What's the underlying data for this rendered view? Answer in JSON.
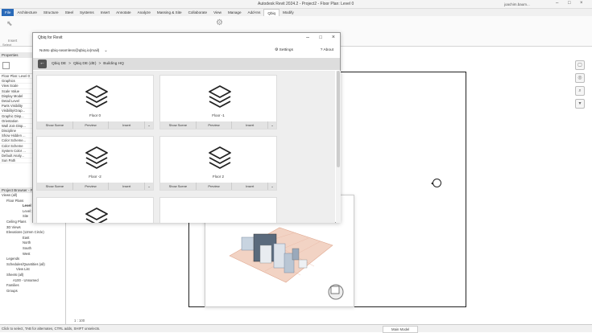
{
  "titlebar": {
    "title": "Autodesk Revit 2024.2 - Project2 - Floor Plan: Level 0",
    "user": "joachim.baum..."
  },
  "ribbon_tabs": [
    "File",
    "Architecture",
    "Structure",
    "Steel",
    "Systems",
    "Insert",
    "Annotate",
    "Analyze",
    "Massing & Site",
    "Collaborate",
    "View",
    "Manage",
    "Add-Ins",
    "Qbiq",
    "Modify"
  ],
  "ribbon": {
    "insert_label": "Insert",
    "select_label": "Select"
  },
  "properties": {
    "title": "Properties",
    "type": "Floor Plan: Level 0",
    "rows": [
      "Graphics",
      "View Scale",
      "Scale Value",
      "Display Model",
      "Detail Level",
      "Parts Visibility",
      "Visibility/Grap...",
      "Graphic Disp...",
      "Orientation",
      "Wall Join Disp...",
      "Discipline",
      "Show Hidden ...",
      "Color Scheme...",
      "Color Scheme",
      "System Color ...",
      "Default Analy...",
      "Sun Path"
    ]
  },
  "browser": {
    "title": "Project Browser - Project2",
    "items": [
      "Views (all)",
      "Floor Plans",
      "Level 0",
      "Level 1",
      "Site",
      "Ceiling Plans",
      "3D Views",
      "Elevations (12mm Circle)",
      "East",
      "North",
      "South",
      "West",
      "Legends",
      "Schedules/Quantities (all)",
      "View List",
      "Sheets (all)",
      "A100 - Unnamed",
      "Families",
      "Groups"
    ]
  },
  "dialog": {
    "title": "Qbiq for Revit",
    "workspace": "NoMo qbiq-seamless@qbiq.io(mail)",
    "settings": "Settings",
    "about": "About",
    "crumbs": [
      "Qbiq DE",
      ">",
      "Qbiq DE (dE)",
      ">",
      "Building HQ"
    ],
    "actions": {
      "show": "Show Scene",
      "preview": "Preview",
      "insert": "Insert"
    },
    "cards": [
      {
        "label": "Floor 0"
      },
      {
        "label": "Floor -1"
      },
      {
        "label": "Floor -2"
      },
      {
        "label": "Floor 2"
      }
    ]
  },
  "view_control": {
    "scale": "1 : 100"
  },
  "status": {
    "text": "Click to select, TAB for alternates, CTRL adds, SHIFT unselects.",
    "model": "Main Model"
  },
  "colors": {
    "file_tab": "#2a6ab8",
    "dialog_border": "#999999"
  }
}
